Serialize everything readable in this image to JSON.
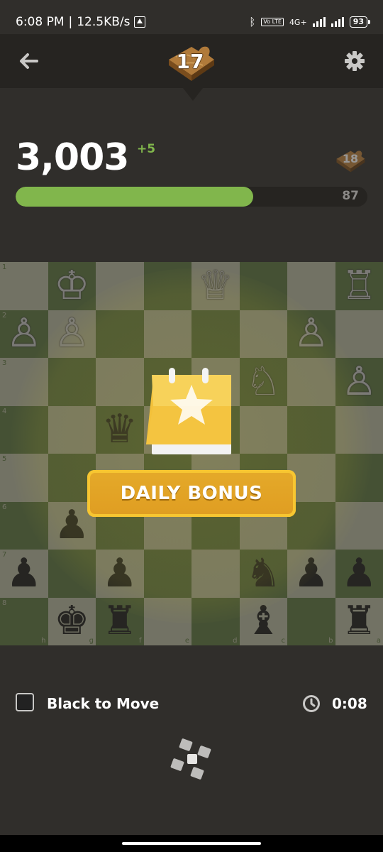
{
  "status_bar": {
    "time": "6:08 PM",
    "speed": "12.5KB/s",
    "network": "4G+",
    "volte": "Vo LTE",
    "battery": "93"
  },
  "header": {
    "puzzle_level": "17",
    "back_icon": "arrow-left-icon",
    "settings_icon": "gear-icon"
  },
  "rating": {
    "value": "3,003",
    "delta": "+5",
    "next_level": "18",
    "progress_remaining": "87",
    "progress_fraction": 0.675,
    "accent_color": "#81b64c"
  },
  "daily_bonus": {
    "label": "DAILY BONUS",
    "icon": "calendar-star-icon"
  },
  "footer": {
    "turn_label": "Black to Move",
    "timer": "0:08",
    "clock_icon": "clock-icon"
  },
  "board": {
    "ranks": [
      [
        "",
        "K",
        "",
        "",
        "Q",
        "",
        "",
        "R"
      ],
      [
        "P",
        "P",
        "",
        "",
        "",
        "",
        "P",
        ""
      ],
      [
        "",
        "",
        "",
        "",
        "",
        "N",
        "",
        "P"
      ],
      [
        "",
        "",
        "q",
        "",
        "",
        "",
        "",
        ""
      ],
      [
        "",
        "",
        "",
        "",
        "",
        "",
        "",
        ""
      ],
      [
        "",
        "p",
        "",
        "",
        "",
        "",
        "",
        ""
      ],
      [
        "p",
        "",
        "p",
        "",
        "",
        "n",
        "p",
        "p"
      ],
      [
        "",
        "k",
        "r",
        "",
        "",
        "b",
        "",
        "r"
      ]
    ],
    "rank_labels": [
      "1",
      "2",
      "3",
      "4",
      "5",
      "6",
      "7",
      "8"
    ],
    "file_labels": [
      "h",
      "g",
      "f",
      "e",
      "d",
      "c",
      "b",
      "a"
    ]
  }
}
